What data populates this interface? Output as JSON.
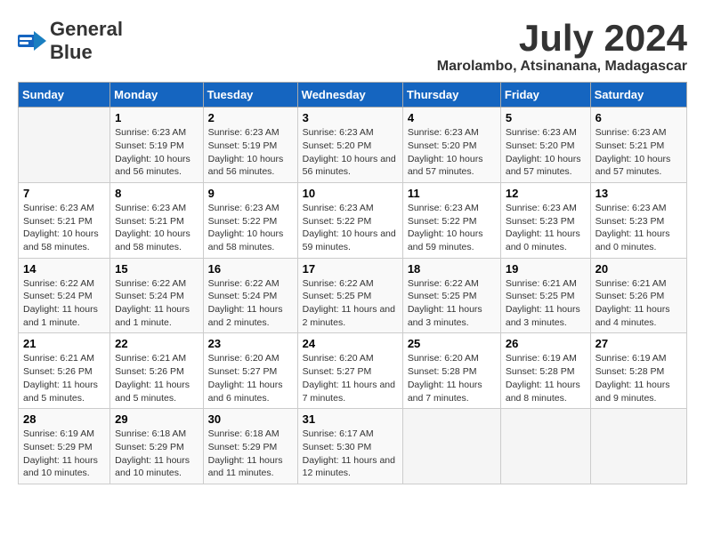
{
  "logo": {
    "general": "General",
    "blue": "Blue"
  },
  "title": "July 2024",
  "subtitle": "Marolambo, Atsinanana, Madagascar",
  "weekdays": [
    "Sunday",
    "Monday",
    "Tuesday",
    "Wednesday",
    "Thursday",
    "Friday",
    "Saturday"
  ],
  "weeks": [
    [
      {
        "day": "",
        "sunrise": "",
        "sunset": "",
        "daylight": ""
      },
      {
        "day": "1",
        "sunrise": "Sunrise: 6:23 AM",
        "sunset": "Sunset: 5:19 PM",
        "daylight": "Daylight: 10 hours and 56 minutes."
      },
      {
        "day": "2",
        "sunrise": "Sunrise: 6:23 AM",
        "sunset": "Sunset: 5:19 PM",
        "daylight": "Daylight: 10 hours and 56 minutes."
      },
      {
        "day": "3",
        "sunrise": "Sunrise: 6:23 AM",
        "sunset": "Sunset: 5:20 PM",
        "daylight": "Daylight: 10 hours and 56 minutes."
      },
      {
        "day": "4",
        "sunrise": "Sunrise: 6:23 AM",
        "sunset": "Sunset: 5:20 PM",
        "daylight": "Daylight: 10 hours and 57 minutes."
      },
      {
        "day": "5",
        "sunrise": "Sunrise: 6:23 AM",
        "sunset": "Sunset: 5:20 PM",
        "daylight": "Daylight: 10 hours and 57 minutes."
      },
      {
        "day": "6",
        "sunrise": "Sunrise: 6:23 AM",
        "sunset": "Sunset: 5:21 PM",
        "daylight": "Daylight: 10 hours and 57 minutes."
      }
    ],
    [
      {
        "day": "7",
        "sunrise": "Sunrise: 6:23 AM",
        "sunset": "Sunset: 5:21 PM",
        "daylight": "Daylight: 10 hours and 58 minutes."
      },
      {
        "day": "8",
        "sunrise": "Sunrise: 6:23 AM",
        "sunset": "Sunset: 5:21 PM",
        "daylight": "Daylight: 10 hours and 58 minutes."
      },
      {
        "day": "9",
        "sunrise": "Sunrise: 6:23 AM",
        "sunset": "Sunset: 5:22 PM",
        "daylight": "Daylight: 10 hours and 58 minutes."
      },
      {
        "day": "10",
        "sunrise": "Sunrise: 6:23 AM",
        "sunset": "Sunset: 5:22 PM",
        "daylight": "Daylight: 10 hours and 59 minutes."
      },
      {
        "day": "11",
        "sunrise": "Sunrise: 6:23 AM",
        "sunset": "Sunset: 5:22 PM",
        "daylight": "Daylight: 10 hours and 59 minutes."
      },
      {
        "day": "12",
        "sunrise": "Sunrise: 6:23 AM",
        "sunset": "Sunset: 5:23 PM",
        "daylight": "Daylight: 11 hours and 0 minutes."
      },
      {
        "day": "13",
        "sunrise": "Sunrise: 6:23 AM",
        "sunset": "Sunset: 5:23 PM",
        "daylight": "Daylight: 11 hours and 0 minutes."
      }
    ],
    [
      {
        "day": "14",
        "sunrise": "Sunrise: 6:22 AM",
        "sunset": "Sunset: 5:24 PM",
        "daylight": "Daylight: 11 hours and 1 minute."
      },
      {
        "day": "15",
        "sunrise": "Sunrise: 6:22 AM",
        "sunset": "Sunset: 5:24 PM",
        "daylight": "Daylight: 11 hours and 1 minute."
      },
      {
        "day": "16",
        "sunrise": "Sunrise: 6:22 AM",
        "sunset": "Sunset: 5:24 PM",
        "daylight": "Daylight: 11 hours and 2 minutes."
      },
      {
        "day": "17",
        "sunrise": "Sunrise: 6:22 AM",
        "sunset": "Sunset: 5:25 PM",
        "daylight": "Daylight: 11 hours and 2 minutes."
      },
      {
        "day": "18",
        "sunrise": "Sunrise: 6:22 AM",
        "sunset": "Sunset: 5:25 PM",
        "daylight": "Daylight: 11 hours and 3 minutes."
      },
      {
        "day": "19",
        "sunrise": "Sunrise: 6:21 AM",
        "sunset": "Sunset: 5:25 PM",
        "daylight": "Daylight: 11 hours and 3 minutes."
      },
      {
        "day": "20",
        "sunrise": "Sunrise: 6:21 AM",
        "sunset": "Sunset: 5:26 PM",
        "daylight": "Daylight: 11 hours and 4 minutes."
      }
    ],
    [
      {
        "day": "21",
        "sunrise": "Sunrise: 6:21 AM",
        "sunset": "Sunset: 5:26 PM",
        "daylight": "Daylight: 11 hours and 5 minutes."
      },
      {
        "day": "22",
        "sunrise": "Sunrise: 6:21 AM",
        "sunset": "Sunset: 5:26 PM",
        "daylight": "Daylight: 11 hours and 5 minutes."
      },
      {
        "day": "23",
        "sunrise": "Sunrise: 6:20 AM",
        "sunset": "Sunset: 5:27 PM",
        "daylight": "Daylight: 11 hours and 6 minutes."
      },
      {
        "day": "24",
        "sunrise": "Sunrise: 6:20 AM",
        "sunset": "Sunset: 5:27 PM",
        "daylight": "Daylight: 11 hours and 7 minutes."
      },
      {
        "day": "25",
        "sunrise": "Sunrise: 6:20 AM",
        "sunset": "Sunset: 5:28 PM",
        "daylight": "Daylight: 11 hours and 7 minutes."
      },
      {
        "day": "26",
        "sunrise": "Sunrise: 6:19 AM",
        "sunset": "Sunset: 5:28 PM",
        "daylight": "Daylight: 11 hours and 8 minutes."
      },
      {
        "day": "27",
        "sunrise": "Sunrise: 6:19 AM",
        "sunset": "Sunset: 5:28 PM",
        "daylight": "Daylight: 11 hours and 9 minutes."
      }
    ],
    [
      {
        "day": "28",
        "sunrise": "Sunrise: 6:19 AM",
        "sunset": "Sunset: 5:29 PM",
        "daylight": "Daylight: 11 hours and 10 minutes."
      },
      {
        "day": "29",
        "sunrise": "Sunrise: 6:18 AM",
        "sunset": "Sunset: 5:29 PM",
        "daylight": "Daylight: 11 hours and 10 minutes."
      },
      {
        "day": "30",
        "sunrise": "Sunrise: 6:18 AM",
        "sunset": "Sunset: 5:29 PM",
        "daylight": "Daylight: 11 hours and 11 minutes."
      },
      {
        "day": "31",
        "sunrise": "Sunrise: 6:17 AM",
        "sunset": "Sunset: 5:30 PM",
        "daylight": "Daylight: 11 hours and 12 minutes."
      },
      {
        "day": "",
        "sunrise": "",
        "sunset": "",
        "daylight": ""
      },
      {
        "day": "",
        "sunrise": "",
        "sunset": "",
        "daylight": ""
      },
      {
        "day": "",
        "sunrise": "",
        "sunset": "",
        "daylight": ""
      }
    ]
  ]
}
